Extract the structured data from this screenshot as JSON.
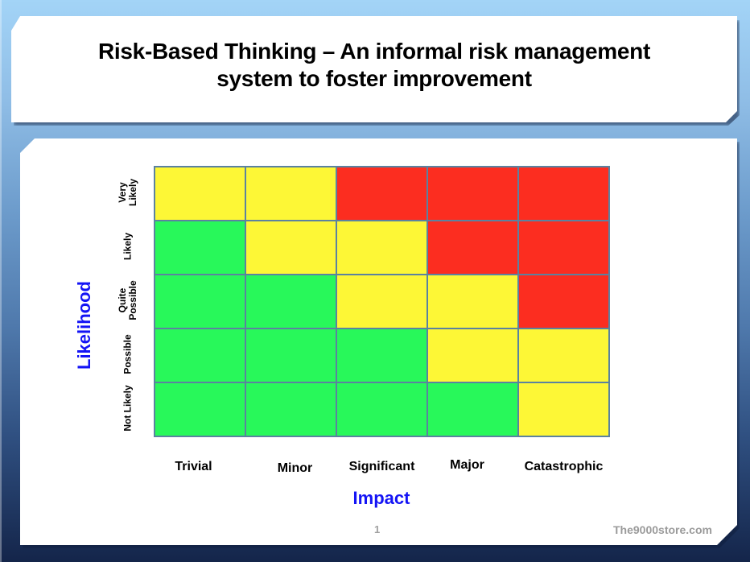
{
  "slide": {
    "title_line1": "Risk-Based Thinking – An informal risk management",
    "title_line2": "system to foster improvement",
    "page_number": "1",
    "footer_text": "The9000store.com"
  },
  "colors": {
    "low": "#28f85a",
    "medium": "#fdf736",
    "high": "#fc2d20",
    "grid_line": "#5b82a0",
    "axis_title": "#1414f5"
  },
  "chart_data": {
    "type": "heatmap",
    "title": "Risk-Based Thinking – An informal risk management system to foster improvement",
    "xlabel": "Impact",
    "ylabel": "Likelihood",
    "x_categories": [
      "Trivial",
      "Minor",
      "Significant",
      "Major",
      "Catastrophic"
    ],
    "y_categories_top_to_bottom": [
      "Very\nLikely",
      "Likely",
      "Quite\nPossible",
      "Possible",
      "Not Likely"
    ],
    "legend": {
      "low": "green",
      "medium": "yellow",
      "high": "red"
    },
    "cells": [
      [
        "medium",
        "medium",
        "high",
        "high",
        "high"
      ],
      [
        "low",
        "medium",
        "medium",
        "high",
        "high"
      ],
      [
        "low",
        "low",
        "medium",
        "medium",
        "high"
      ],
      [
        "low",
        "low",
        "low",
        "medium",
        "medium"
      ],
      [
        "low",
        "low",
        "low",
        "low",
        "medium"
      ]
    ]
  }
}
